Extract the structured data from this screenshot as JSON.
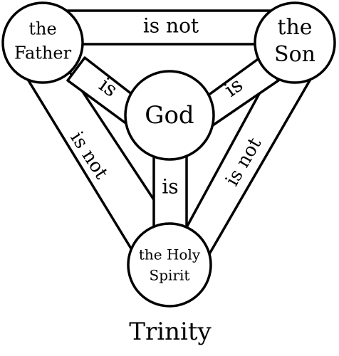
{
  "title": "Trinity",
  "colors": {
    "stroke": "#000000",
    "fill": "#ffffff"
  },
  "nodes": {
    "father": [
      "the",
      "Father"
    ],
    "son": [
      "the",
      "Son"
    ],
    "god": "God",
    "spirit": [
      "the Holy",
      "Spirit"
    ]
  },
  "relations": {
    "father_son": "is not",
    "father_spirit": "is not",
    "son_spirit": "is not",
    "father_god": "is",
    "son_god": "is",
    "god_spirit": "is"
  }
}
